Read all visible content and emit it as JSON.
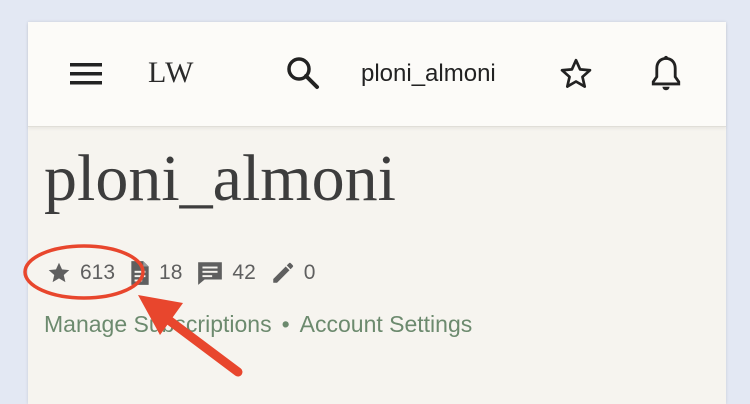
{
  "header": {
    "logo": "LW",
    "username": "ploni_almoni",
    "icons": [
      "menu-icon",
      "search-icon",
      "star-outline-icon",
      "bell-icon"
    ]
  },
  "profile": {
    "username": "ploni_almoni",
    "stats": {
      "karma": "613",
      "posts": "18",
      "comments": "42",
      "edits": "0"
    },
    "links": {
      "manage_subscriptions": "Manage Subscriptions",
      "separator": "•",
      "account_settings": "Account Settings"
    }
  },
  "annotation": {
    "color": "#e8462d"
  },
  "colors": {
    "page_bg": "#e3e8f3",
    "card_bg": "#f6f4ef",
    "link": "#6c8a6e"
  }
}
